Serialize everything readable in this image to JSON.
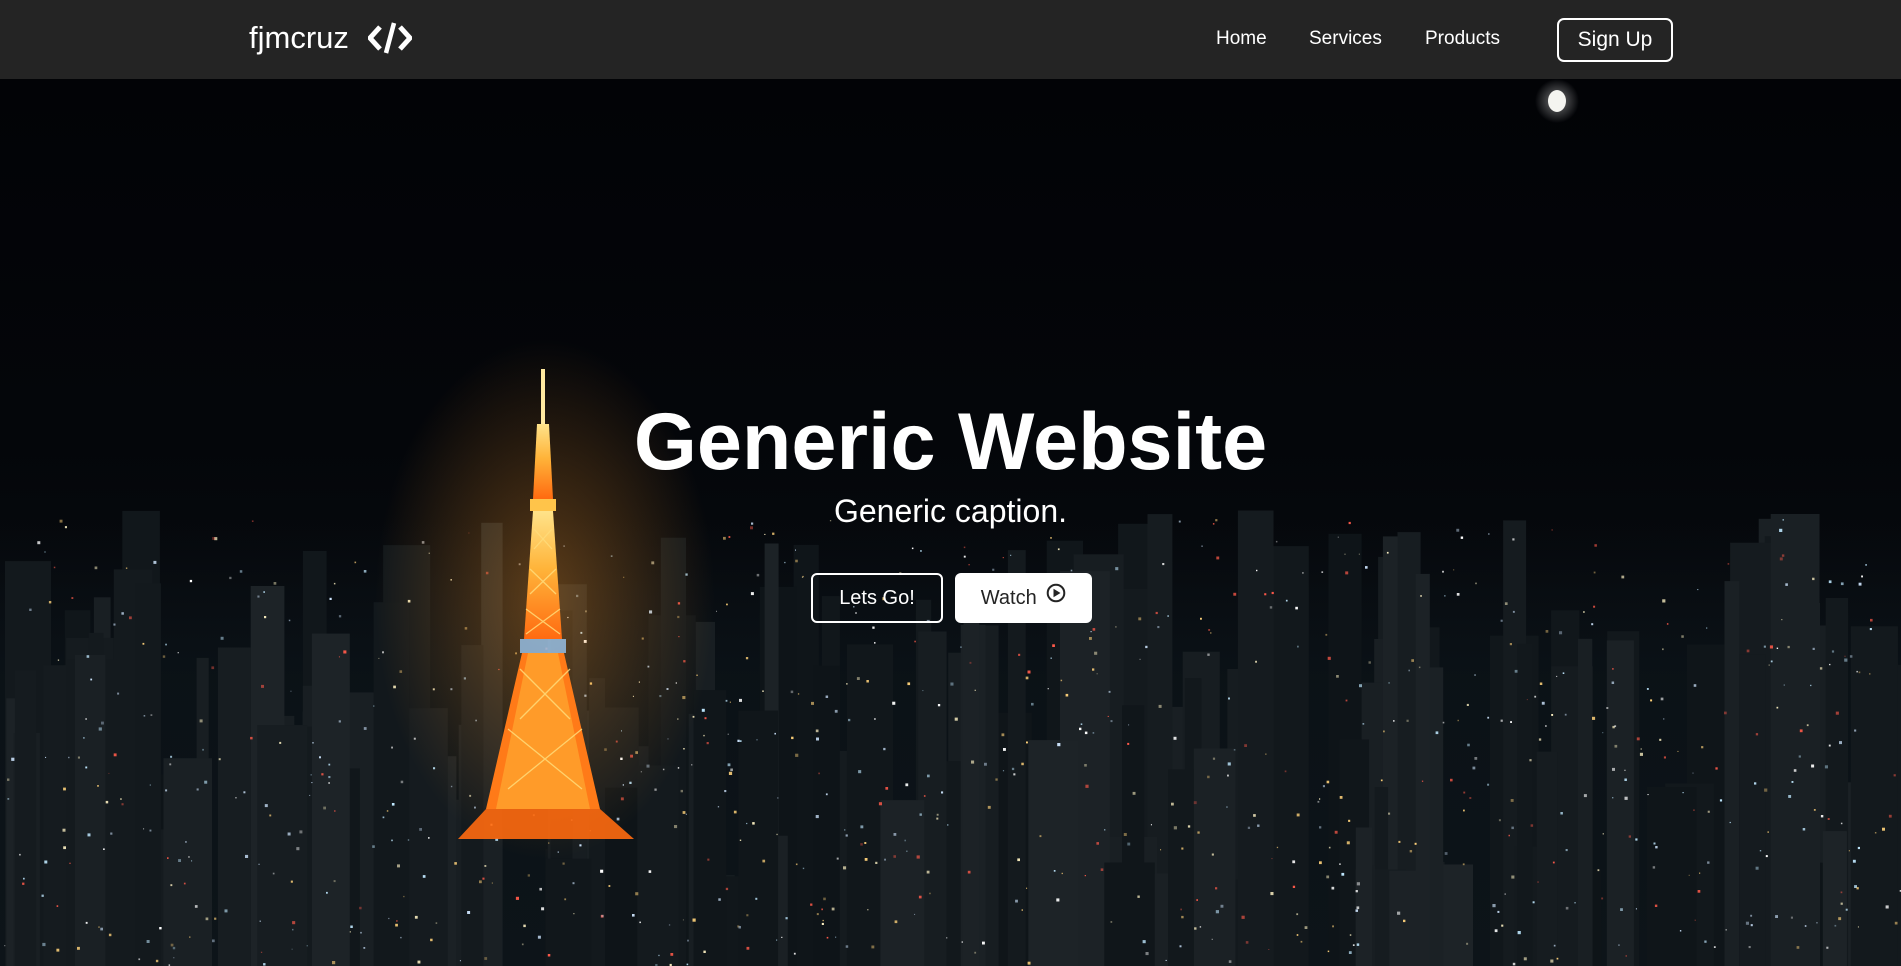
{
  "navbar": {
    "logo_text": "fjmcruz",
    "logo_icon": "code-icon",
    "links": [
      "Home",
      "Services",
      "Products"
    ],
    "signup_label": "Sign Up"
  },
  "hero": {
    "title": "Generic Website",
    "caption": "Generic caption.",
    "primary_button": "Lets Go!",
    "secondary_button": "Watch",
    "secondary_icon": "play-circle-icon",
    "background": "night-city-skyline-with-illuminated-tower"
  },
  "colors": {
    "navbar_bg": "#242424",
    "text": "#ffffff",
    "tower_orange": "#ff8a1c",
    "tower_yellow": "#ffd24a"
  }
}
